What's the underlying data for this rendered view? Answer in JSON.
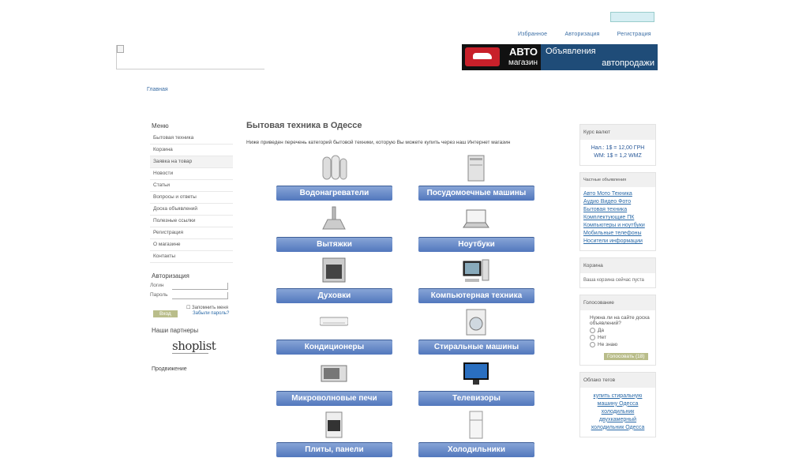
{
  "header": {
    "links": [
      "Избранное",
      "Авторизация",
      "Регистрация"
    ],
    "banner": {
      "top_left": "АВТО",
      "bottom_left": "магазин",
      "top_right": "Объявления",
      "bottom_right": "автопродажи"
    }
  },
  "breadcrumb": "Главная",
  "sidebar": {
    "menu_title": "Меню",
    "menu": [
      "Бытовая техника",
      "Корзина",
      "Заявка на товар",
      "Новости",
      "Статьи",
      "Вопросы и ответы",
      "Доска объявлений",
      "Полезные ссылки",
      "Регистрация",
      "О магазине",
      "Контакты"
    ],
    "auth_title": "Авторизация",
    "login_label": "Логин",
    "password_label": "Пароль",
    "login_button": "Вход",
    "remember": "Запомнить меня",
    "forgot": "Забыли пароль?",
    "partners_title": "Наши партнеры",
    "partner_logo": "shoplist",
    "promo_title": "Продвижение"
  },
  "main": {
    "title": "Бытовая техника в Одессе",
    "intro": "Ниже приведен перечень категорий бытовой техники, которую Вы можете купить через наш Интернет магазин",
    "categories": [
      "Водонагреватели",
      "Посудомоечные машины",
      "Вытяжки",
      "Ноутбуки",
      "Духовки",
      "Компьютерная техника",
      "Кондиционеры",
      "Стиральные машины",
      "Микроволновые печи",
      "Телевизоры",
      "Плиты, панели",
      "Холодильники"
    ]
  },
  "right": {
    "rate_title": "Курс валют",
    "rate_lines": [
      "Нал.: 1$ = 12,00 ГРН",
      "WM: 1$ = 1,2 WMZ"
    ],
    "sections_title": "Частные объявления",
    "sections": [
      "Авто Мото Техника",
      "Аудио Видео Фото",
      "Бытовая техника",
      "Комплектующие ПК",
      "Компьютеры и ноутбуки",
      "Мобильные телефоны",
      "Носители информации"
    ],
    "cart_title": "Корзина",
    "cart_text": "Ваша корзина сейчас пуста",
    "poll_title": "Голосование",
    "poll_question": "Нужна ли на сайте доска объявлений?",
    "poll_options": [
      "Да",
      "Нет",
      "Не знаю"
    ],
    "vote_button": "Голосовать (18)",
    "tags_title": "Облако тегов",
    "tags": [
      "купить стиральную машину Одесса",
      "холодильник",
      "двухкамерный холодильник Одесса"
    ]
  }
}
